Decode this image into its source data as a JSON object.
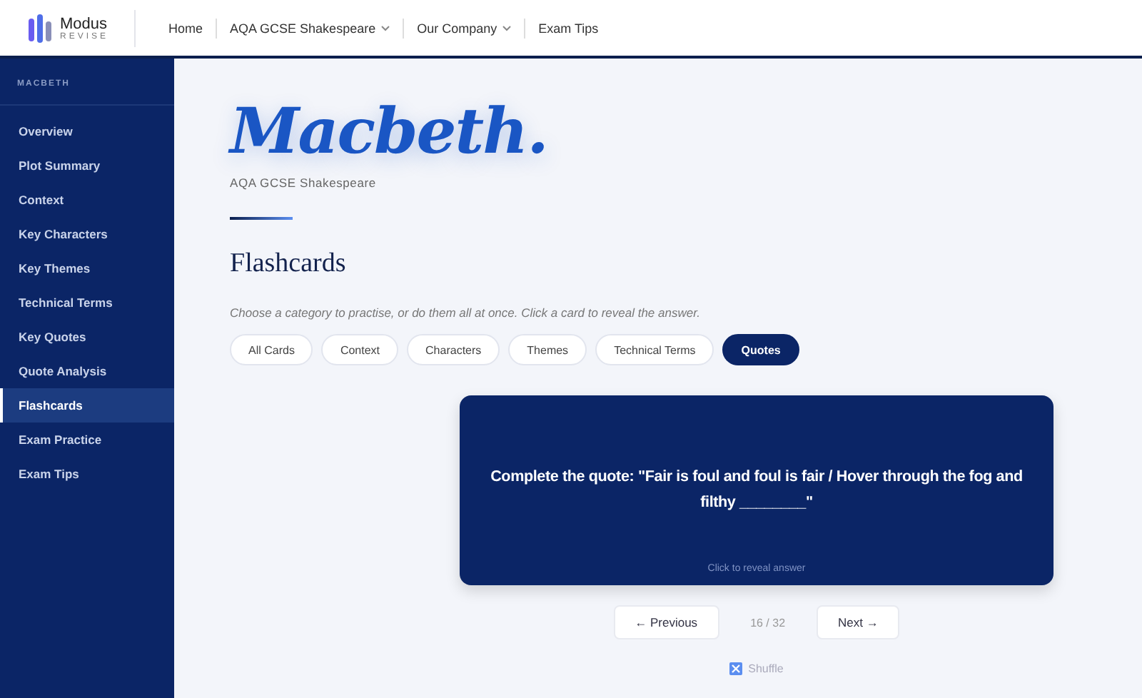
{
  "header": {
    "logo": {
      "name": "Modus",
      "tagline": "REVISE"
    },
    "nav": [
      {
        "label": "Home",
        "dropdown": false
      },
      {
        "label": "AQA GCSE Shakespeare",
        "dropdown": true
      },
      {
        "label": "Our Company",
        "dropdown": true
      },
      {
        "label": "Exam Tips",
        "dropdown": false
      }
    ]
  },
  "sidebar": {
    "heading": "MACBETH",
    "items": [
      {
        "label": "Overview",
        "selected": false
      },
      {
        "label": "Plot Summary",
        "selected": false
      },
      {
        "label": "Context",
        "selected": false
      },
      {
        "label": "Key Characters",
        "selected": false
      },
      {
        "label": "Key Themes",
        "selected": false
      },
      {
        "label": "Technical Terms",
        "selected": false
      },
      {
        "label": "Key Quotes",
        "selected": false
      },
      {
        "label": "Quote Analysis",
        "selected": false
      },
      {
        "label": "Flashcards",
        "selected": true
      },
      {
        "label": "Exam Practice",
        "selected": false
      },
      {
        "label": "Exam Tips",
        "selected": false
      }
    ]
  },
  "hero": {
    "title": "Macbeth.",
    "subtitle": "AQA GCSE Shakespeare"
  },
  "section": {
    "title": "Flashcards",
    "intro": "Choose a category to practise, or do them all at once. Click a card to reveal the answer."
  },
  "filters": [
    {
      "label": "All Cards",
      "selected": false
    },
    {
      "label": "Context",
      "selected": false
    },
    {
      "label": "Characters",
      "selected": false
    },
    {
      "label": "Themes",
      "selected": false
    },
    {
      "label": "Technical Terms",
      "selected": false
    },
    {
      "label": "Quotes",
      "selected": true
    }
  ],
  "card": {
    "question": "Complete the quote: \"Fair is foul and foul is fair / Hover through the fog and filthy ________\"",
    "hint": "Click to reveal answer"
  },
  "pager": {
    "previous": "← Previous",
    "position": "16 / 32",
    "next": "Next →"
  },
  "shuffle": {
    "label": "Shuffle"
  }
}
